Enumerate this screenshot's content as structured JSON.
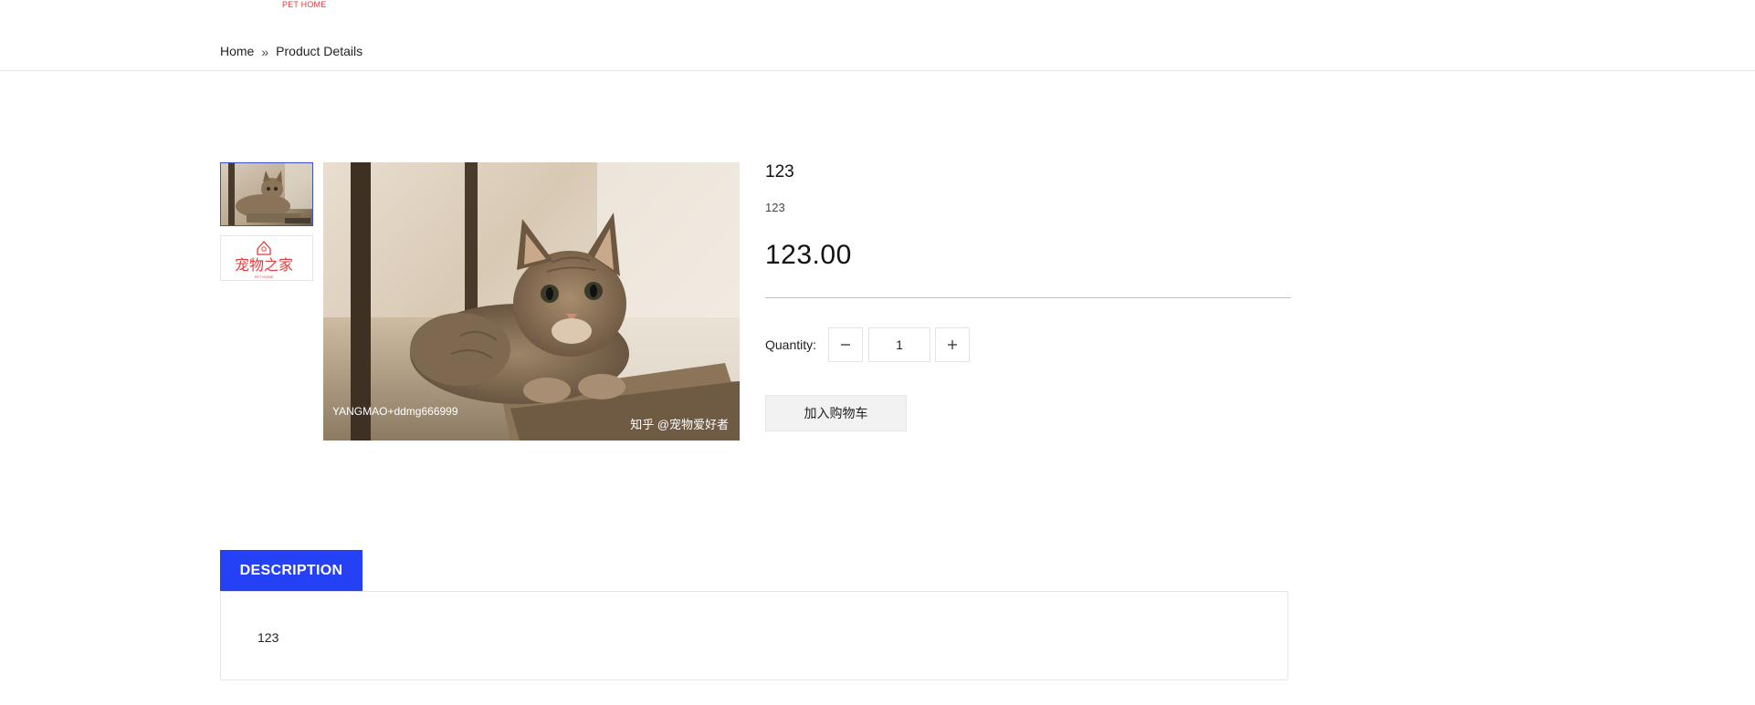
{
  "header": {
    "logo_sub": "PET HOME"
  },
  "breadcrumb": {
    "home": "Home",
    "separator": "»",
    "current": "Product Details"
  },
  "gallery": {
    "thumbnails": [
      {
        "name": "cat-photo",
        "active": true
      },
      {
        "name": "pet-home-logo",
        "logo_text": "宠物之家",
        "logo_sub": "PET HOME",
        "active": false
      }
    ],
    "main_image": {
      "watermark_left": "YANGMAO+ddmg666999",
      "watermark_right": "知乎 @宠物爱好者"
    }
  },
  "product": {
    "title": "123",
    "subtitle": "123",
    "price": "123.00",
    "quantity_label": "Quantity:",
    "quantity_value": "1",
    "add_to_cart_label": "加入购物车"
  },
  "tabs": {
    "description_label": "DESCRIPTION",
    "description_text": "123"
  },
  "colors": {
    "accent": "#2541f5",
    "logo_red": "#e63b3b",
    "thumb_active_border": "#3b4fd4"
  },
  "icons": {
    "breadcrumb_sep": "double-chevron-right-icon",
    "minus": "minus-icon",
    "plus": "plus-icon"
  }
}
